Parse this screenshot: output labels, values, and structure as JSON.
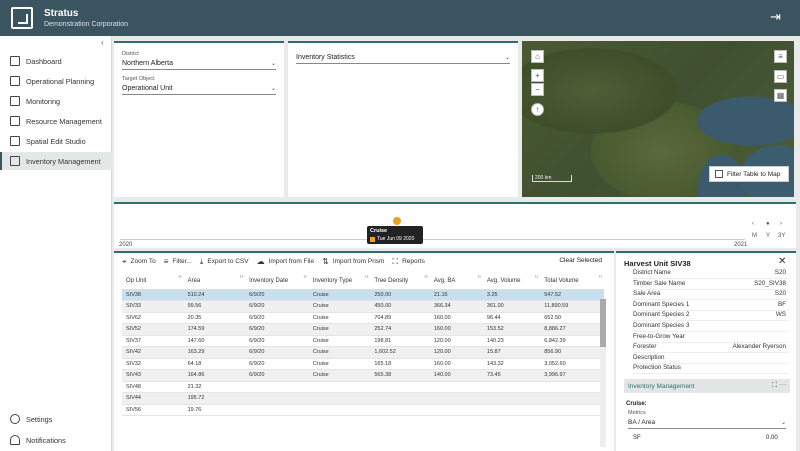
{
  "app": {
    "title": "Stratus",
    "subtitle": "Demonstration Corporation"
  },
  "sidebar": {
    "items": [
      {
        "label": "Dashboard",
        "icon": "monitor-icon"
      },
      {
        "label": "Operational Planning",
        "icon": "planning-icon"
      },
      {
        "label": "Monitoring",
        "icon": "monitoring-icon"
      },
      {
        "label": "Resource Management",
        "icon": "resource-icon"
      },
      {
        "label": "Spatial Edit Studio",
        "icon": "edit-icon"
      },
      {
        "label": "Inventory Management",
        "icon": "inventory-icon",
        "active": true
      }
    ],
    "bottom": [
      {
        "label": "Settings",
        "icon": "gear-icon"
      },
      {
        "label": "Notifications",
        "icon": "bell-icon"
      }
    ]
  },
  "filters": {
    "district_label": "District",
    "district_value": "Northern Alberta",
    "target_label": "Target Object",
    "target_value": "Operational Unit"
  },
  "stats": {
    "label": "Inventory Statistics"
  },
  "map": {
    "scale": "200 km",
    "filter_label": "Filter Table to Map"
  },
  "timeline": {
    "start": "2020",
    "end": "2021",
    "tooltip_title": "Cruise",
    "tooltip_date": "Tue Jun 09 2020",
    "controls": [
      "M",
      "Y",
      "3Y"
    ]
  },
  "toolbar": {
    "zoom": "Zoom To",
    "filter": "Filter...",
    "export": "Export to CSV",
    "import_file": "Import from File",
    "import_prism": "Import from Prism",
    "reports": "Reports",
    "clear": "Clear Selected"
  },
  "table": {
    "columns": [
      "Op Unit",
      "Area",
      "Inventory Date",
      "Inventory Type",
      "Tree Density",
      "Avg. BA",
      "Avg. Volume",
      "Total Volume"
    ],
    "rows": [
      [
        "SIV38",
        "510.24",
        "6/9/20",
        "Cruise",
        "250.00",
        "21.16",
        "3.25",
        "547.52"
      ],
      [
        "SIV33",
        "99.56",
        "6/9/20",
        "Cruise",
        "450.00",
        "366.34",
        "361.00",
        "11,890.59"
      ],
      [
        "SIV62",
        "20.35",
        "6/9/20",
        "Cruise",
        "704.89",
        "160.00",
        "96.44",
        "652.50"
      ],
      [
        "SIV52",
        "174.59",
        "6/9/20",
        "Cruise",
        "252.74",
        "160.00",
        "153.52",
        "8,886.27"
      ],
      [
        "SIV37",
        "147.60",
        "6/9/20",
        "Cruise",
        "198.81",
        "120.00",
        "140.23",
        "6,842.39"
      ],
      [
        "SIV42",
        "163.29",
        "6/9/20",
        "Cruise",
        "1,602.52",
        "120.00",
        "15.87",
        "856.90"
      ],
      [
        "SIV32",
        "64.18",
        "6/9/20",
        "Cruise",
        "165.18",
        "160.00",
        "143.32",
        "3,052.60"
      ],
      [
        "SIV43",
        "164.86",
        "6/9/20",
        "Cruise",
        "565.38",
        "140.00",
        "73.45",
        "3,996.97"
      ],
      [
        "SIV48",
        "21.32",
        "",
        "",
        "",
        "",
        "",
        ""
      ],
      [
        "SIV44",
        "195.72",
        "",
        "",
        "",
        "",
        "",
        ""
      ],
      [
        "SIV56",
        "19.76",
        "",
        "",
        "",
        "",
        "",
        ""
      ]
    ]
  },
  "detail": {
    "title": "Harvest Unit SIV38",
    "fields": [
      {
        "label": "District Name",
        "value": "S20"
      },
      {
        "label": "Timber Sale Name",
        "value": "S20_SIV38"
      },
      {
        "label": "Sale Area",
        "value": "S20"
      },
      {
        "label": "Dominant Species 1",
        "value": "BF"
      },
      {
        "label": "Dominant Species 2",
        "value": "WS"
      },
      {
        "label": "Dominant Species 3",
        "value": ""
      },
      {
        "label": "Free-to-Grow Year",
        "value": ""
      },
      {
        "label": "Forester",
        "value": "Alexander Ryerson"
      },
      {
        "label": "Description",
        "value": ""
      },
      {
        "label": "Protection Status",
        "value": ""
      }
    ],
    "section": "Inventory Management",
    "cruise_label": "Cruise:",
    "metrics_label": "Metrics",
    "metrics_value": "BA / Area",
    "sf_label": "SF",
    "sf_value": "0.00"
  }
}
